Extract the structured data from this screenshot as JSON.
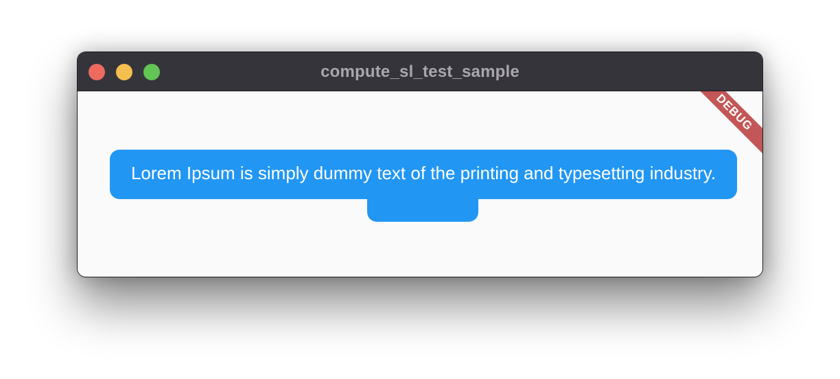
{
  "window": {
    "title": "compute_sl_test_sample"
  },
  "content": {
    "message": "Lorem Ipsum is simply dummy text of the printing and typesetting industry."
  },
  "debug_banner": {
    "label": "DEBUG"
  },
  "colors": {
    "titlebar": "#36343b",
    "bubble": "#2196f3",
    "banner": "#b42828",
    "close": "#ed6a5e",
    "minimize": "#f5bf4f",
    "maximize": "#61c454"
  }
}
